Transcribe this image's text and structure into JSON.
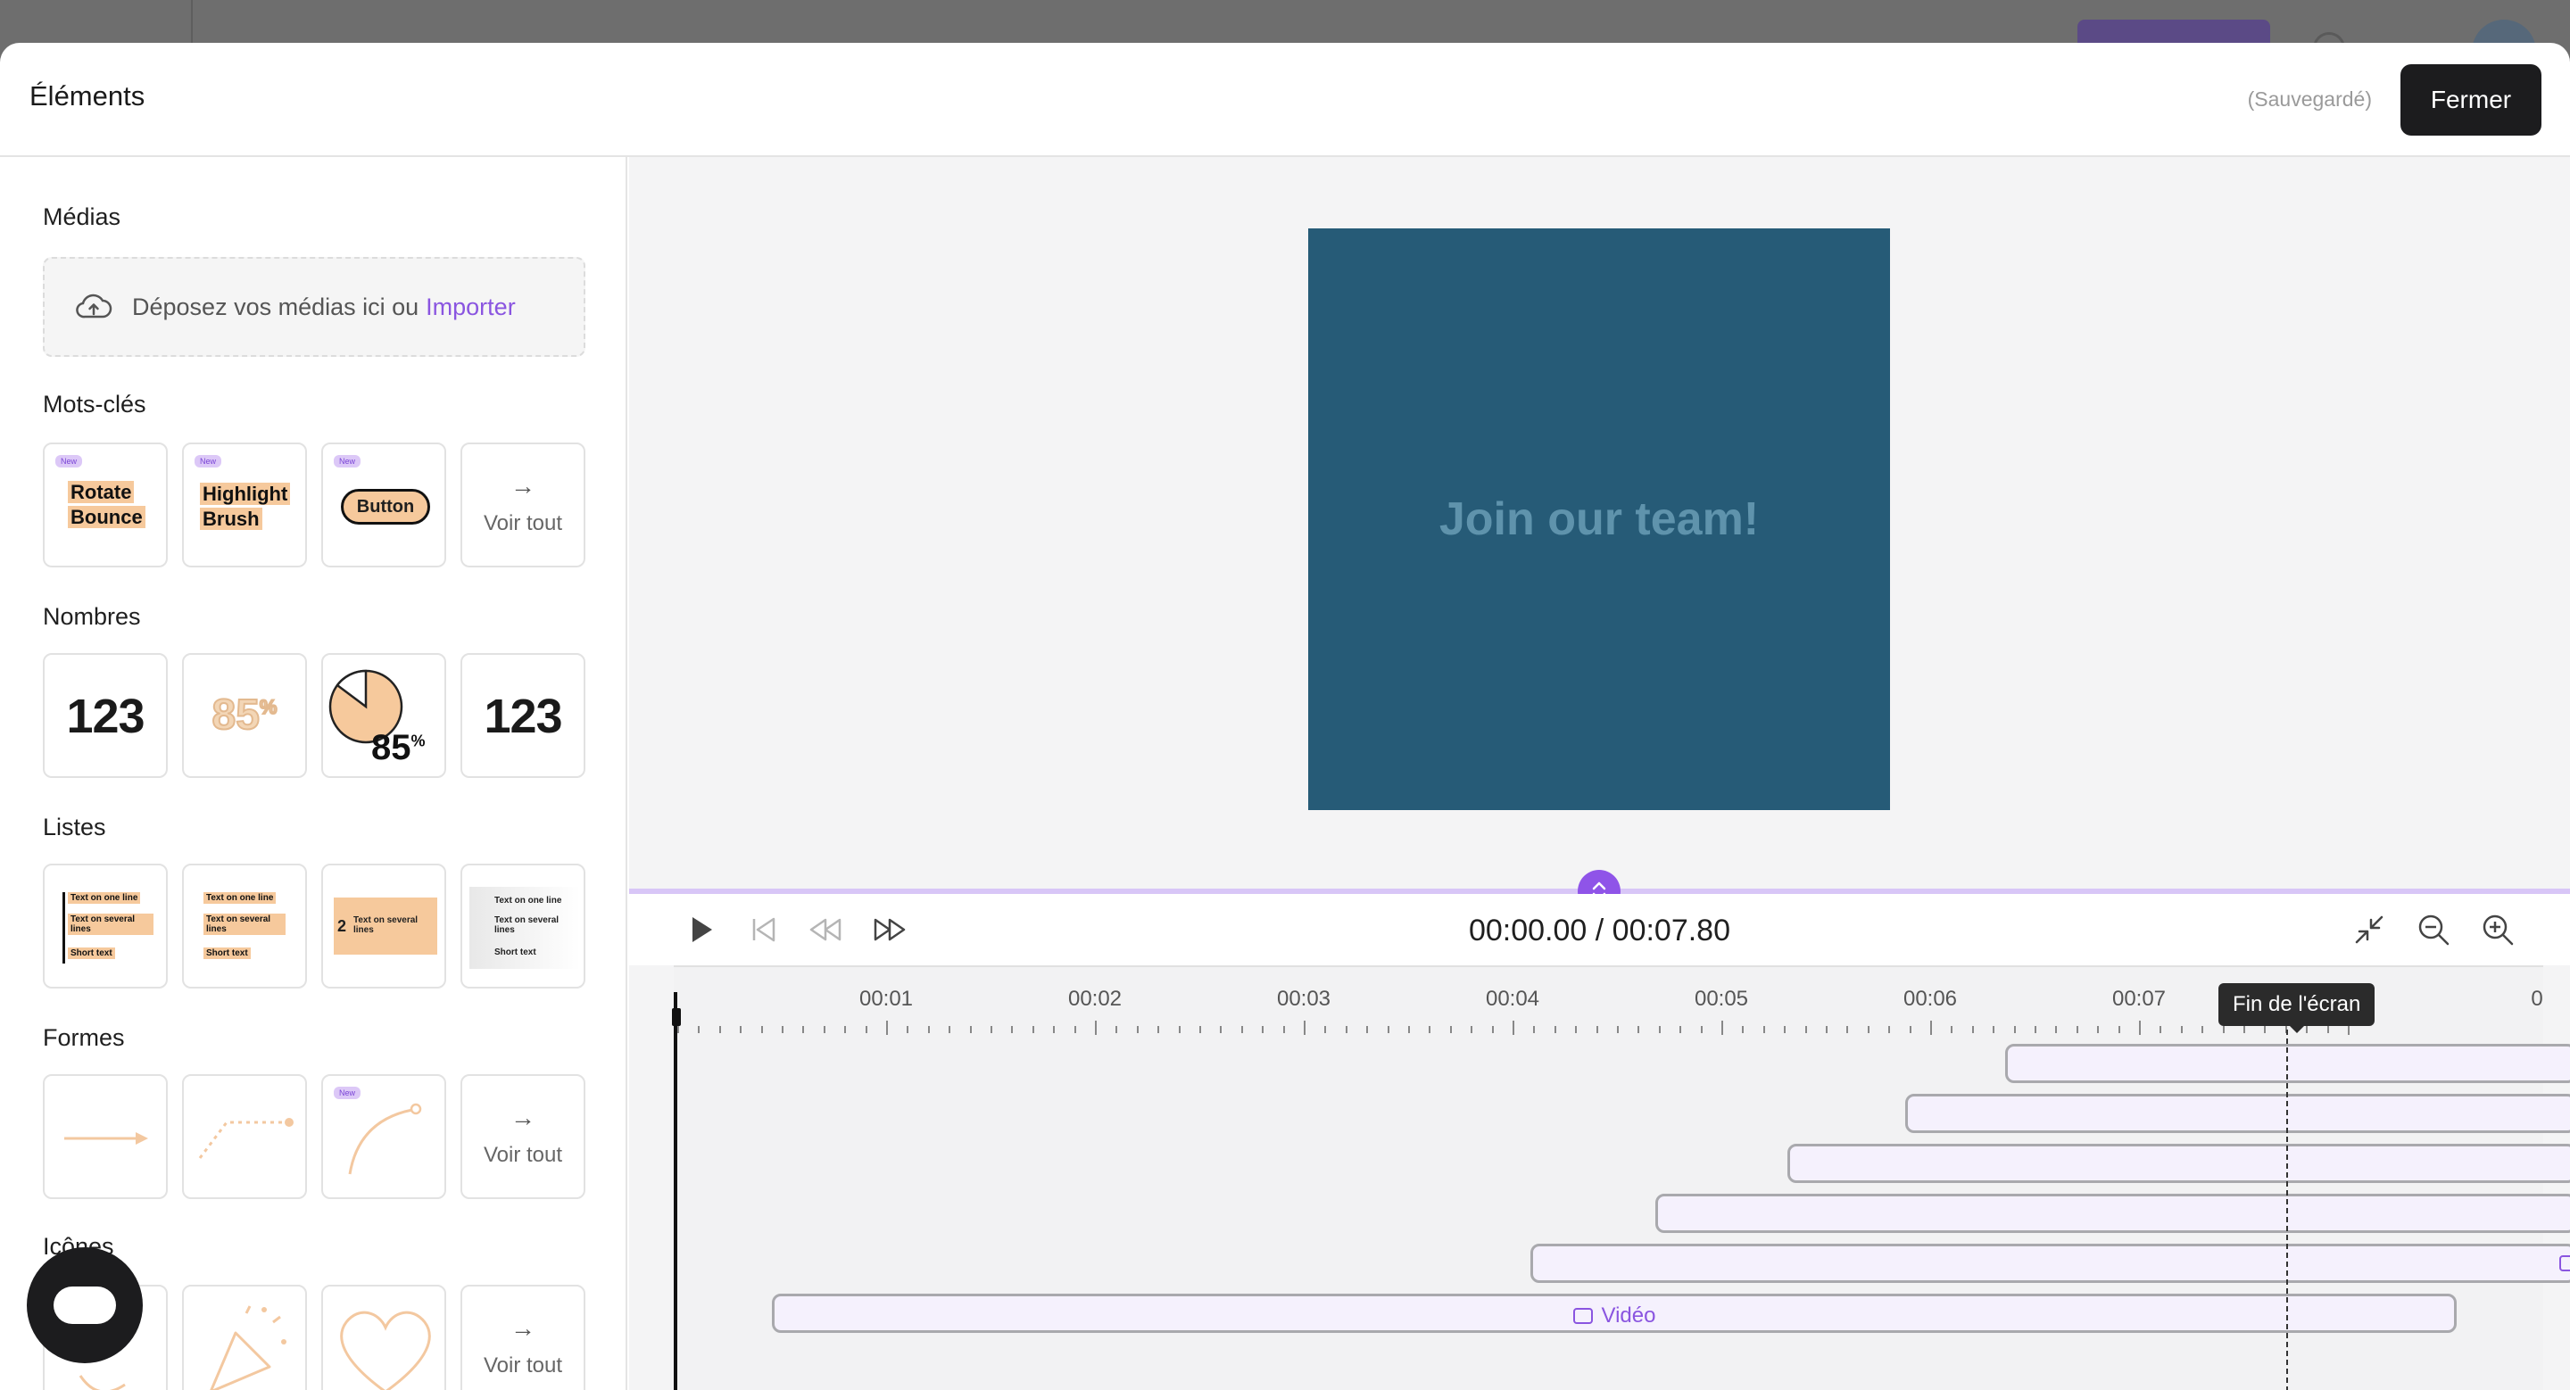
{
  "header": {
    "title": "Éléments",
    "saved_status": "(Sauvegardé)",
    "close_label": "Fermer"
  },
  "sidebar": {
    "medias": {
      "title": "Médias",
      "drop_text": "Déposez vos médias ici ou",
      "import_link": "Importer"
    },
    "keywords": {
      "title": "Mots-clés",
      "new_badge": "New",
      "item1": [
        "Rotate",
        "Bounce"
      ],
      "item2": [
        "Highlight",
        "Brush"
      ],
      "item3": "Button",
      "see_all": "Voir tout"
    },
    "numbers": {
      "title": "Nombres",
      "item1": "123",
      "item2": "85",
      "item2_suffix": "%",
      "item3": "85",
      "item3_suffix": "%",
      "item4": "123"
    },
    "lists": {
      "title": "Listes",
      "one_line": "Text on one line",
      "several": "Text on several lines",
      "short": "Short text",
      "number": "2"
    },
    "shapes": {
      "title": "Formes",
      "new_badge": "New",
      "see_all": "Voir tout"
    },
    "icons": {
      "title": "Icônes",
      "see_all": "Voir tout"
    }
  },
  "canvas": {
    "text": "Join our team!",
    "background": "#265b77"
  },
  "player": {
    "time": "00:00.00 / 00:07.80"
  },
  "timeline": {
    "labels": [
      "00:01",
      "00:02",
      "00:03",
      "00:04",
      "00:05",
      "00:06",
      "00:07",
      "0"
    ],
    "end_tooltip": "Fin de l'écran",
    "video_label": "Vidéo",
    "accent": "#8f54e8"
  }
}
